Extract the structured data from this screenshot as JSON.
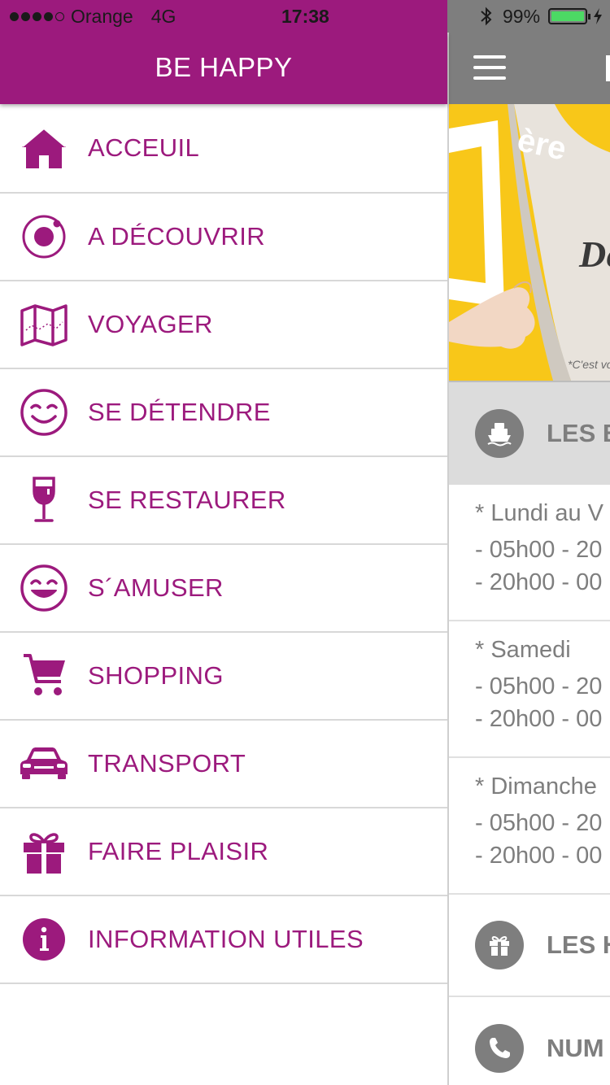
{
  "status_bar": {
    "carrier": "Orange",
    "network": "4G",
    "time": "17:38",
    "battery_percent": "99%",
    "battery_level": 0.99,
    "signal_bars_filled": 4,
    "signal_bars_total": 5
  },
  "drawer": {
    "title": "BE HAPPY",
    "accent_color": "#9c1a7d",
    "items": [
      {
        "label": "ACCEUIL",
        "icon": "home-icon"
      },
      {
        "label": "A DÉCOUVRIR",
        "icon": "discover-icon"
      },
      {
        "label": "VOYAGER",
        "icon": "map-icon"
      },
      {
        "label": "SE DÉTENDRE",
        "icon": "smile-icon"
      },
      {
        "label": "SE RESTAURER",
        "icon": "wine-glass-icon"
      },
      {
        "label": "S´AMUSER",
        "icon": "happy-face-icon"
      },
      {
        "label": "SHOPPING",
        "icon": "cart-icon"
      },
      {
        "label": "TRANSPORT",
        "icon": "car-icon"
      },
      {
        "label": "FAIRE PLAISIR",
        "icon": "gift-icon"
      },
      {
        "label": "INFORMATION UTILES",
        "icon": "info-icon"
      }
    ]
  },
  "main": {
    "header_color": "#7e7e7e",
    "banner": {
      "text_fragments": [
        "ère",
        "De",
        "*C'est vo"
      ]
    },
    "boats_section": {
      "title": "LES B",
      "icon": "boat-icon"
    },
    "schedules": [
      {
        "day": "* Lundi au V",
        "slots": [
          "- 05h00 - 20",
          "- 20h00 - 00"
        ]
      },
      {
        "day": "* Samedi",
        "slots": [
          "- 05h00 - 20",
          "- 20h00 - 00"
        ]
      },
      {
        "day": "* Dimanche",
        "slots": [
          "- 05h00 - 20",
          "- 20h00 - 00"
        ]
      }
    ],
    "gift_section": {
      "title": "LES H",
      "icon": "gift-icon"
    },
    "phone_section": {
      "title": "NUM",
      "icon": "phone-icon"
    }
  }
}
